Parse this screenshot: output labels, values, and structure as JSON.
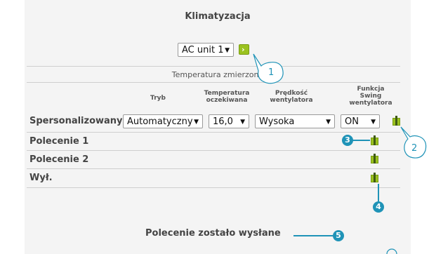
{
  "window": {
    "title": "Klimatyzacja"
  },
  "unit_selector": {
    "value": "AC unit 1"
  },
  "measured": {
    "label": "Temperatura zmierzona"
  },
  "columns": {
    "mode": "Tryb",
    "temp_line1": "Temperatura",
    "temp_line2": "oczekiwana",
    "fan_line1": "Prędkość",
    "fan_line2": "wentylatora",
    "swing_line1": "Funkcja",
    "swing_line2": "Swing",
    "swing_line3": "wentylatora"
  },
  "custom_row": {
    "label": "Spersonalizowany",
    "mode": "Automatyczny",
    "temperature": "16,0",
    "fan_speed": "Wysoka",
    "swing": "ON"
  },
  "commands": [
    {
      "label": "Polecenie 1"
    },
    {
      "label": "Polecenie 2"
    },
    {
      "label": "Wył."
    }
  ],
  "status": {
    "text": "Polecenie zostało wysłane"
  },
  "callouts": [
    "1",
    "2",
    "3",
    "4",
    "5"
  ],
  "colors": {
    "accent": "#1f93b7",
    "send_button": "#9bc21f",
    "panel_bg": "#f4f4f4"
  }
}
